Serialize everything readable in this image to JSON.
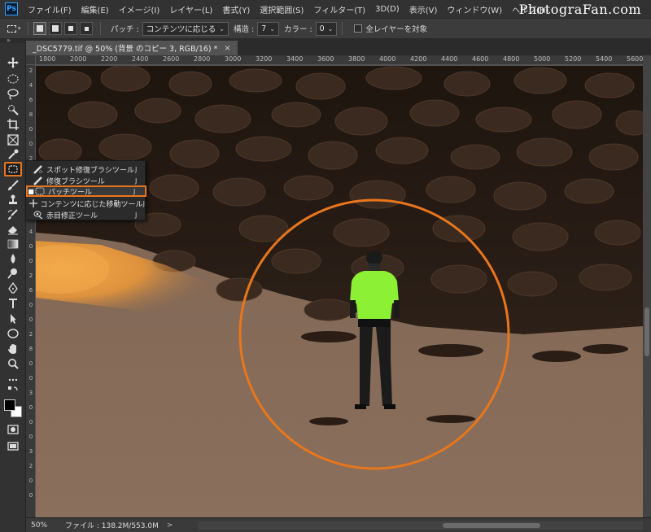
{
  "app": {
    "logo": "Ps"
  },
  "menubar": {
    "items": [
      "ファイル(F)",
      "編集(E)",
      "イメージ(I)",
      "レイヤー(L)",
      "書式(Y)",
      "選択範囲(S)",
      "フィルター(T)",
      "3D(D)",
      "表示(V)",
      "ウィンドウ(W)",
      "ヘルプ(H)"
    ],
    "watermark": "PhotograFan.com"
  },
  "options": {
    "patch_label": "パッチ :",
    "patch_value": "コンテンツに応じる",
    "structure_label": "構造 :",
    "structure_value": "7",
    "color_label": "カラー :",
    "color_value": "0",
    "sample_all_label": "全レイヤーを対象"
  },
  "document": {
    "tab_title": "_DSC5779.tif @ 50% (背景 のコピー 3, RGB/16) *",
    "close_glyph": "×"
  },
  "rulers": {
    "top": [
      "1800",
      "2000",
      "2200",
      "2400",
      "2600",
      "2800",
      "3000",
      "3200",
      "3400",
      "3600",
      "3800",
      "4000",
      "4200",
      "4400",
      "4600",
      "4800",
      "5000",
      "5200",
      "5400",
      "5600"
    ],
    "left": [
      "2",
      "4",
      "6",
      "8",
      "0",
      "0",
      "2",
      "2",
      "0",
      "0",
      "2",
      "4",
      "0",
      "0",
      "2",
      "6",
      "0",
      "0",
      "2",
      "8",
      "0",
      "0",
      "3",
      "0",
      "0",
      "0",
      "3",
      "2",
      "0",
      "0"
    ]
  },
  "flyout": {
    "items": [
      {
        "label": "スポット修復ブラシツール",
        "key": "J",
        "icon": "spot-healing-brush-icon",
        "active": false
      },
      {
        "label": "修復ブラシツール",
        "key": "J",
        "icon": "healing-brush-icon",
        "active": false
      },
      {
        "label": "パッチツール",
        "key": "J",
        "icon": "patch-icon",
        "active": true,
        "marker": "■"
      },
      {
        "label": "コンテンツに応じた移動ツール",
        "key": "J",
        "icon": "content-aware-move-icon",
        "active": false
      },
      {
        "label": "赤目修正ツール",
        "key": "J",
        "icon": "red-eye-icon",
        "active": false
      }
    ]
  },
  "statusbar": {
    "zoom": "50%",
    "doc_info": "ファイル : 138.2M/553.0M",
    "arrow": ">"
  },
  "colors": {
    "highlight": "#e8761d",
    "shirt": "#8cf034",
    "foreground": "#000000",
    "background": "#ffffff"
  }
}
